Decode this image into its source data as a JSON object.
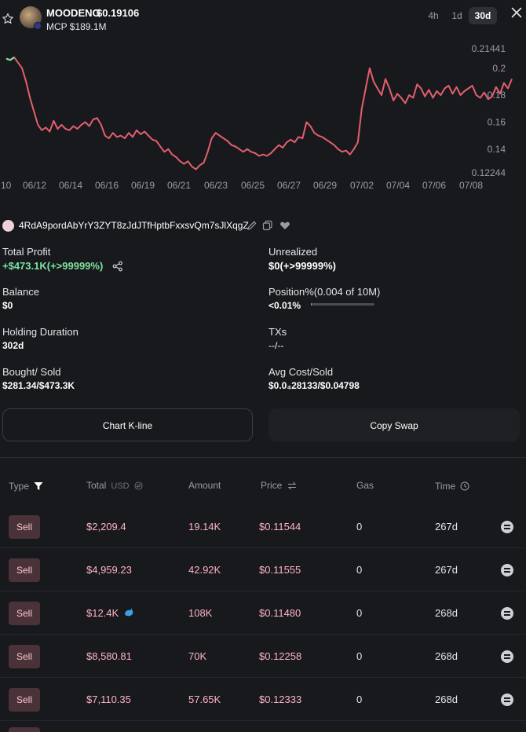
{
  "header": {
    "token_name": "MOODENG",
    "token_price": "$0.19106",
    "mcp": "MCP $189.1M",
    "timeframes": [
      "4h",
      "1d",
      "30d"
    ],
    "active_timeframe": "30d"
  },
  "chart_data": {
    "type": "line",
    "x_ticks": [
      "10",
      "06/12",
      "06/14",
      "06/16",
      "06/19",
      "06/21",
      "06/23",
      "06/25",
      "06/27",
      "06/29",
      "07/02",
      "07/04",
      "07/06",
      "07/08"
    ],
    "y_ticks": [
      "0.21441",
      "0.2",
      "0.18",
      "0.16",
      "0.14",
      "0.12244"
    ],
    "ylim": [
      0.12244,
      0.21441
    ],
    "line_color": "#e45f6e",
    "start_marker_color": "#7ee2a0",
    "values": [
      0.207,
      0.206,
      0.208,
      0.204,
      0.2,
      0.19,
      0.178,
      0.168,
      0.158,
      0.154,
      0.156,
      0.153,
      0.161,
      0.155,
      0.158,
      0.155,
      0.154,
      0.157,
      0.155,
      0.158,
      0.16,
      0.157,
      0.162,
      0.163,
      0.158,
      0.15,
      0.148,
      0.152,
      0.149,
      0.15,
      0.148,
      0.152,
      0.149,
      0.154,
      0.151,
      0.153,
      0.15,
      0.147,
      0.146,
      0.142,
      0.138,
      0.14,
      0.136,
      0.134,
      0.131,
      0.129,
      0.131,
      0.127,
      0.125,
      0.128,
      0.13,
      0.138,
      0.148,
      0.152,
      0.15,
      0.148,
      0.146,
      0.143,
      0.142,
      0.14,
      0.138,
      0.14,
      0.138,
      0.137,
      0.135,
      0.136,
      0.135,
      0.137,
      0.14,
      0.143,
      0.141,
      0.145,
      0.147,
      0.145,
      0.149,
      0.148,
      0.16,
      0.157,
      0.152,
      0.15,
      0.149,
      0.147,
      0.145,
      0.143,
      0.14,
      0.138,
      0.139,
      0.136,
      0.14,
      0.145,
      0.17,
      0.185,
      0.2,
      0.19,
      0.185,
      0.18,
      0.192,
      0.185,
      0.176,
      0.181,
      0.178,
      0.174,
      0.18,
      0.178,
      0.188,
      0.185,
      0.179,
      0.184,
      0.178,
      0.183,
      0.18,
      0.185,
      0.187,
      0.181,
      0.186,
      0.18,
      0.183,
      0.185,
      0.187,
      0.18,
      0.178,
      0.182,
      0.177,
      0.179,
      0.186,
      0.181,
      0.189,
      0.185,
      0.192
    ]
  },
  "wallet": {
    "address": "4RdA9pordAbYrY3ZYT8zJdJTfHptbFxxsvQm7sJlXqgZ"
  },
  "stats": {
    "total_profit_label": "Total Profit",
    "total_profit_value": "+$473.1K(+>99999%)",
    "unrealized_label": "Unrealized",
    "unrealized_value": "$0(+>99999%)",
    "balance_label": "Balance",
    "balance_value": "$0",
    "position_label": "Position%(0.004 of 10M)",
    "position_value": "<0.01%",
    "position_fraction": 0.0001,
    "holding_label": "Holding Duration",
    "holding_value": "302d",
    "txs_label": "TXs",
    "txs_value": "--/--",
    "bought_sold_label": "Bought/ Sold",
    "bought_sold_value": "$281.34/$473.3K",
    "avg_cost_label": "Avg Cost/Sold",
    "avg_cost_value": "$0.0₄28133/$0.04798"
  },
  "buttons": {
    "chart_kline": "Chart K-line",
    "copy_swap": "Copy Swap"
  },
  "table": {
    "headers": {
      "type": "Type",
      "total": "Total",
      "usd": "USD",
      "amount": "Amount",
      "price": "Price",
      "gas": "Gas",
      "time": "Time"
    },
    "rows": [
      {
        "type": "Sell",
        "total": "$2,209.4",
        "amount": "19.14K",
        "price": "$0.11544",
        "gas": "0",
        "time": "267d",
        "whale": false
      },
      {
        "type": "Sell",
        "total": "$4,959.23",
        "amount": "42.92K",
        "price": "$0.11555",
        "gas": "0",
        "time": "267d",
        "whale": false
      },
      {
        "type": "Sell",
        "total": "$12.4K",
        "amount": "108K",
        "price": "$0.11480",
        "gas": "0",
        "time": "268d",
        "whale": true
      },
      {
        "type": "Sell",
        "total": "$8,580.81",
        "amount": "70K",
        "price": "$0.12258",
        "gas": "0",
        "time": "268d",
        "whale": false
      },
      {
        "type": "Sell",
        "total": "$7,110.35",
        "amount": "57.65K",
        "price": "$0.12333",
        "gas": "0",
        "time": "268d",
        "whale": false
      }
    ]
  }
}
